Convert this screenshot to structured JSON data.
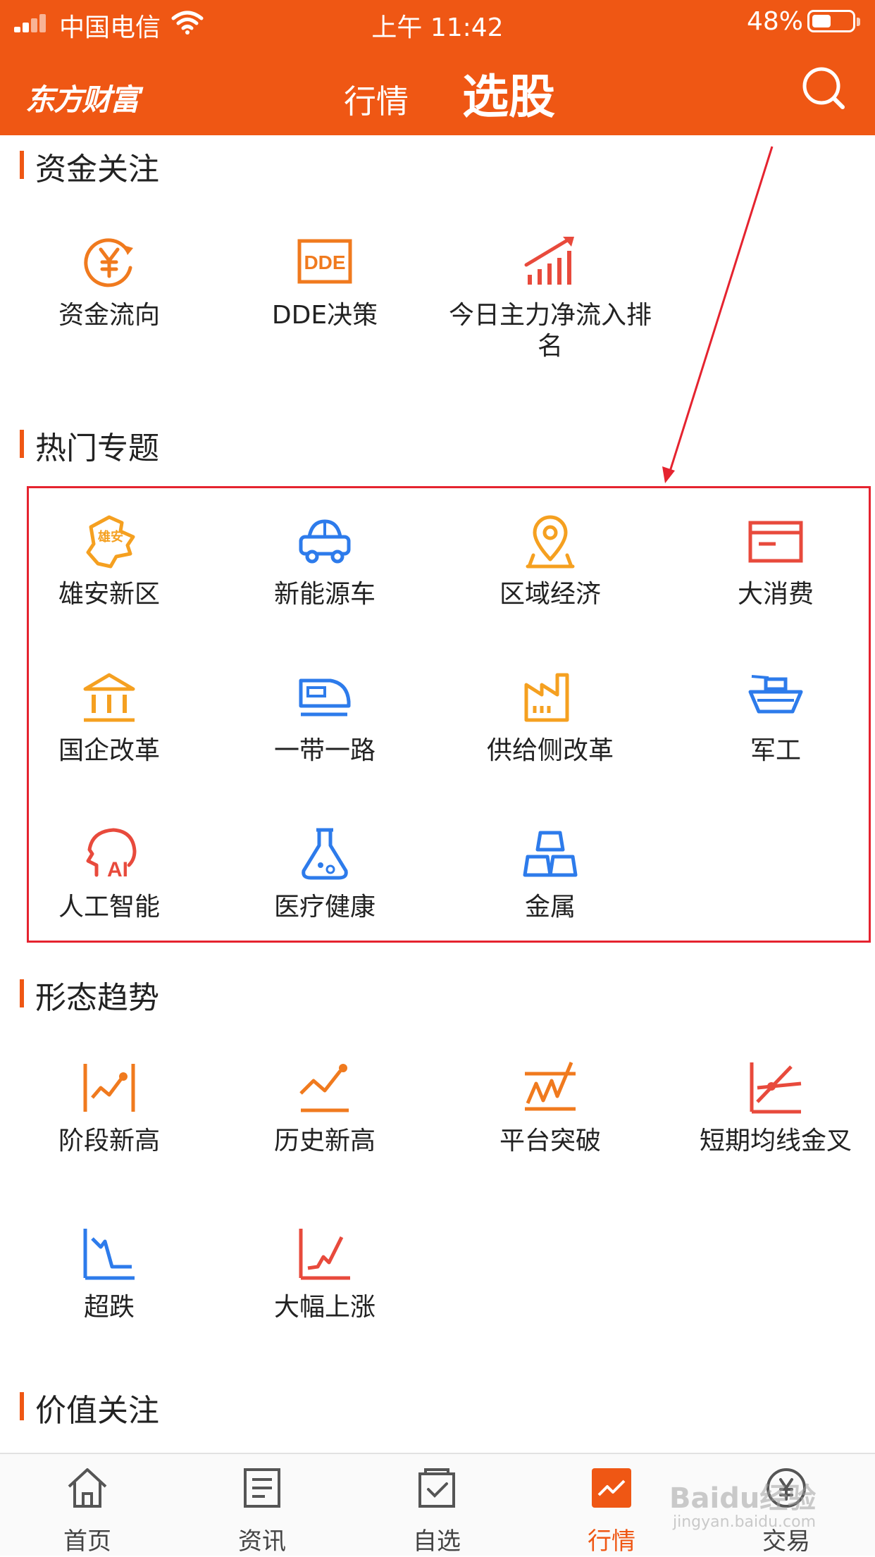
{
  "status_bar": {
    "carrier": "中国电信",
    "time": "上午 11:42",
    "battery": "48%",
    "battery_level": 0.48
  },
  "header": {
    "logo": "东方财富",
    "tab_market": "行情",
    "tab_stock_picker": "选股"
  },
  "sections": {
    "capital": {
      "title": "资金关注",
      "items": [
        {
          "label": "资金流向",
          "icon": "yuan-cycle-icon"
        },
        {
          "label": "DDE决策",
          "icon": "dde-icon"
        },
        {
          "label": "今日主力净流入排名",
          "icon": "rising-bars-icon"
        }
      ]
    },
    "hot": {
      "title": "热门专题",
      "items": [
        {
          "label": "雄安新区",
          "icon": "xiongan-map-icon",
          "badge": "雄安"
        },
        {
          "label": "新能源车",
          "icon": "car-icon"
        },
        {
          "label": "区域经济",
          "icon": "location-pin-icon"
        },
        {
          "label": "大消费",
          "icon": "card-icon"
        },
        {
          "label": "国企改革",
          "icon": "government-building-icon"
        },
        {
          "label": "一带一路",
          "icon": "train-icon"
        },
        {
          "label": "供给侧改革",
          "icon": "factory-icon"
        },
        {
          "label": "军工",
          "icon": "warship-icon"
        },
        {
          "label": "人工智能",
          "icon": "ai-head-icon",
          "badge": "AI"
        },
        {
          "label": "医疗健康",
          "icon": "flask-icon"
        },
        {
          "label": "金属",
          "icon": "gold-bars-icon"
        }
      ]
    },
    "pattern": {
      "title": "形态趋势",
      "items": [
        {
          "label": "阶段新高",
          "icon": "stage-high-icon"
        },
        {
          "label": "历史新高",
          "icon": "history-high-icon"
        },
        {
          "label": "平台突破",
          "icon": "platform-breakout-icon"
        },
        {
          "label": "短期均线金叉",
          "icon": "golden-cross-icon"
        },
        {
          "label": "超跌",
          "icon": "oversold-icon"
        },
        {
          "label": "大幅上涨",
          "icon": "big-rise-icon"
        }
      ]
    },
    "value": {
      "title": "价值关注"
    }
  },
  "tabbar": {
    "items": [
      {
        "label": "首页",
        "icon": "home-icon"
      },
      {
        "label": "资讯",
        "icon": "news-icon"
      },
      {
        "label": "自选",
        "icon": "watchlist-icon"
      },
      {
        "label": "行情",
        "icon": "market-chart-icon"
      },
      {
        "label": "交易",
        "icon": "trade-icon"
      }
    ],
    "active": "行情"
  },
  "watermark": {
    "text": "Baidu经验",
    "url": "jingyan.baidu.com"
  },
  "colors": {
    "brand": "#EF5714",
    "orange": "#F5A020",
    "blue": "#2D7BEB",
    "red": "#E84A3C",
    "highlight": "#E5232F"
  }
}
